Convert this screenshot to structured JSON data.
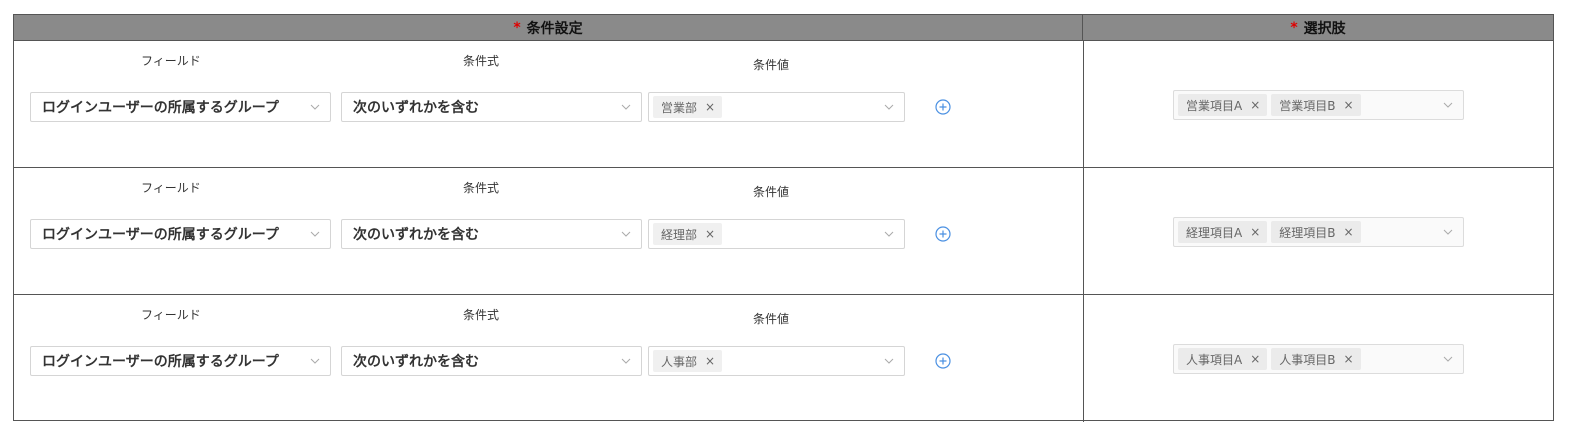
{
  "header": {
    "required_mark": "*",
    "condition_title": "条件設定",
    "choices_title": "選択肢"
  },
  "labels": {
    "field": "フィールド",
    "operator": "条件式",
    "value": "条件値"
  },
  "rows": [
    {
      "field": "ログインユーザーの所属するグループ",
      "operator": "次のいずれかを含む",
      "value_tags": [
        "営業部"
      ],
      "choice_tags": [
        "営業項目A",
        "営業項目B"
      ]
    },
    {
      "field": "ログインユーザーの所属するグループ",
      "operator": "次のいずれかを含む",
      "value_tags": [
        "経理部"
      ],
      "choice_tags": [
        "経理項目A",
        "経理項目B"
      ]
    },
    {
      "field": "ログインユーザーの所属するグループ",
      "operator": "次のいずれかを含む",
      "value_tags": [
        "人事部"
      ],
      "choice_tags": [
        "人事項目A",
        "人事項目B"
      ]
    }
  ],
  "icons": {
    "remove_tag": "×",
    "add": "plus-circle-icon",
    "dropdown": "chevron-down-icon"
  },
  "colors": {
    "required": "#e00000",
    "header_bg": "#8a8a8a",
    "add_icon": "#4a90e2"
  }
}
